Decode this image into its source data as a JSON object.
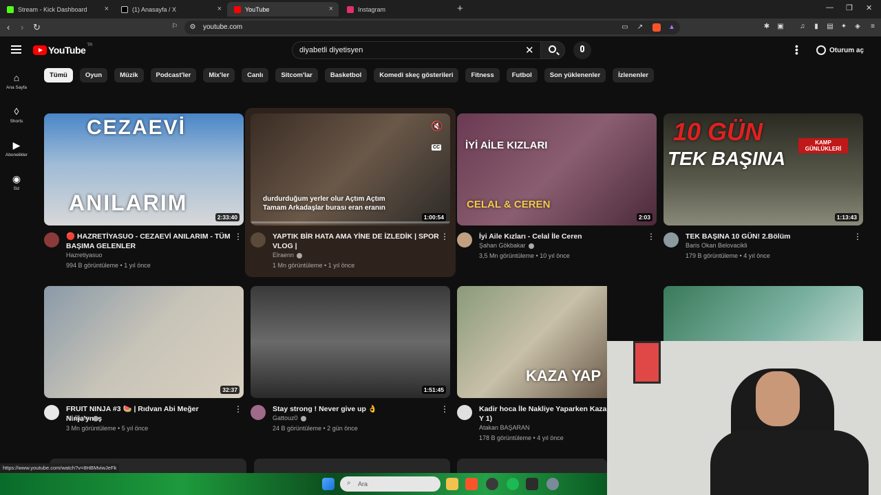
{
  "browser": {
    "tabs": [
      {
        "title": "Stream - Kick Dashboard",
        "color": "#53fc18"
      },
      {
        "title": "(1) Anasayfa / X",
        "color": "#ffffff"
      },
      {
        "title": "YouTube",
        "color": "#ff0000"
      },
      {
        "title": "Instagram",
        "color": "#e1306c"
      }
    ],
    "url": "youtube.com"
  },
  "header": {
    "logo_word": "YouTube",
    "logo_country": "TR",
    "search_value": "diyabetli diyetisyen",
    "signin_label": "Oturum aç"
  },
  "sidebar": {
    "items": [
      {
        "label": "Ana Sayfa",
        "icon": "home-icon"
      },
      {
        "label": "Shorts",
        "icon": "shorts-icon"
      },
      {
        "label": "Abonelikler",
        "icon": "subscriptions-icon"
      },
      {
        "label": "Siz",
        "icon": "you-icon"
      }
    ]
  },
  "chips": [
    "Tümü",
    "Oyun",
    "Müzik",
    "Podcast'ler",
    "Mix'ler",
    "Canlı",
    "Sitcom'lar",
    "Basketbol",
    "Komedi skeç gösterileri",
    "Fitness",
    "Futbol",
    "Son yüklenenler",
    "İzlenenler"
  ],
  "videos": [
    {
      "thumb_text_top": "CEZAEVİ",
      "thumb_text_bottom": "ANILARIM",
      "duration": "2:33:40",
      "title": "🔴 HAZRETİYASUO - CEZAEVİ ANILARIM - TÜM BAŞIMA GELENLER",
      "channel": "Hazretiyasuo",
      "stats": "994 B görüntüleme • 1 yıl önce",
      "colors": [
        "#3a6ea8",
        "#8da9c4"
      ]
    },
    {
      "thumb_caption": "durdurduğum yerler olur Açtım Açtım Tamam Arkadaşlar burası eran eranın",
      "duration": "1:00:54",
      "cc": "CC",
      "title": "YAPTIK BİR HATA AMA YİNE DE İZLEDİK | SPOR VLOG |",
      "channel": "Elraenn",
      "stats": "1 Mn görüntüleme • 1 yıl önce",
      "colors": [
        "#4a3a30",
        "#7a6a5a"
      ]
    },
    {
      "thumb_text_top": "İYİ AİLE KIZLARI",
      "thumb_text_bottom": "CELAL & CEREN",
      "duration": "2:03",
      "title": "İyi Aile Kızları - Celal İle Ceren",
      "channel": "Şahan Gökbakar",
      "stats": "3,5 Mn görüntüleme • 10 yıl önce",
      "colors": [
        "#5a3a4a",
        "#8a6070"
      ]
    },
    {
      "thumb_text_top": "10 GÜN",
      "thumb_text_bottom": "TEK BAŞINA",
      "thumb_badge": "KAMP GÜNLÜKLERİ",
      "duration": "1:13:43",
      "title": "TEK BAŞINA 10 GÜN! 2.Bölüm",
      "channel": "Baris Okan Belovacikli",
      "stats": "179 B görüntüleme • 4 yıl önce",
      "colors": [
        "#2e2e26",
        "#6a6a5c"
      ]
    },
    {
      "duration": "32:37",
      "title": "FRUIT NINJA #3 🍉 | Rıdvan Abi Meğer Ninja'ymış",
      "channel": "Ali Biçim",
      "stats": "3 Mn görüntüleme • 5 yıl önce",
      "colors": [
        "#6a7a8a",
        "#c8c0b0"
      ]
    },
    {
      "duration": "1:51:45",
      "title": "Stay strong ! Never give up 👌",
      "channel": "Gattouz0",
      "stats": "24 B görüntüleme • 2 gün önce",
      "colors": [
        "#4a4a4a",
        "#9a9a9a"
      ]
    },
    {
      "thumb_text_top": "KAZA YAP",
      "title": "Kadir hoca İle Nakliye Yaparken Kaza Y 1)",
      "channel": "Atakan BAŞARAN",
      "stats": "178 B görüntüleme • 4 yıl önce",
      "colors": [
        "#7a8a6a",
        "#c0b8a0"
      ]
    },
    {
      "colors": [
        "#3a8a6a",
        "#8ab8a8"
      ]
    }
  ],
  "status_url": "https://www.youtube.com/watch?v=8HBMviwJeFk",
  "taskbar": {
    "search_placeholder": "Ara"
  }
}
